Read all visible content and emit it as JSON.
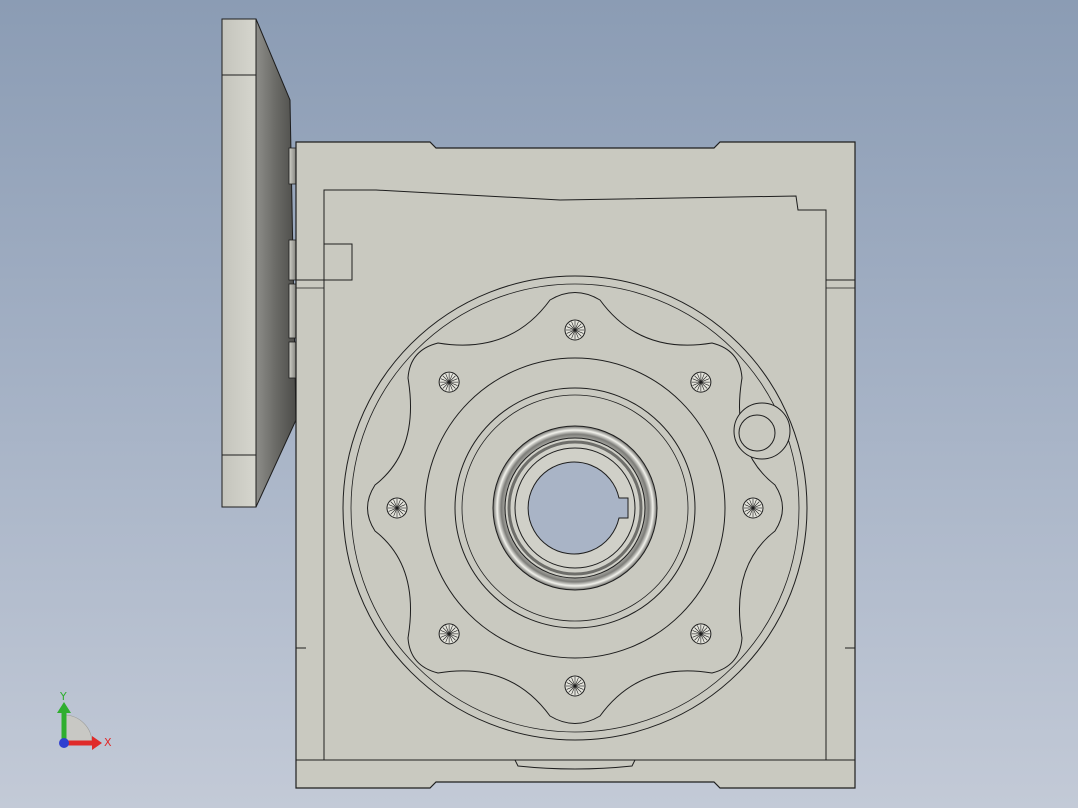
{
  "viewport": {
    "background_top": "#8b9cb4",
    "background_bottom": "#c3cad7"
  },
  "model": {
    "body_color": "#c9c9c0",
    "edge_color": "#1e1e1e",
    "flange_shadow_color": "#6e6e6a",
    "bore_color": "#a9b4c6"
  },
  "triad": {
    "y_label": "Y",
    "x_label": "X",
    "y_color": "#2fae2f",
    "x_color": "#e02a2a",
    "z_color": "#2f3fd0",
    "icon": "coordinate-axes-icon"
  }
}
